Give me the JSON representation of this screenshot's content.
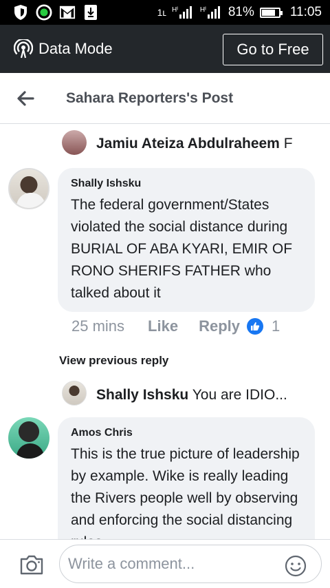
{
  "status_bar": {
    "network_label": "1ʟ",
    "sim1": "Hᴵ",
    "sim2": "Hᴵ",
    "battery_percent": "81%",
    "battery_level": 0.81,
    "time": "11:05",
    "icons": [
      "shield-icon",
      "data-saver-icon",
      "gmail-icon",
      "download-icon",
      "signal-icon",
      "battery-icon"
    ]
  },
  "data_mode": {
    "label": "Data Mode",
    "button": "Go to Free"
  },
  "header": {
    "title": "Sahara Reporters's Post"
  },
  "comments": [
    {
      "type": "reply_preview",
      "name": "Jamiu Ateiza Abdulraheem",
      "text": "F"
    },
    {
      "type": "comment",
      "name": "Shally Ishsku",
      "text": "The federal government/States violated the social distance during BURIAL OF ABA KYARI, EMIR OF RONO SHERIFS FATHER  who talked about it",
      "time": "25 mins",
      "like_label": "Like",
      "reply_label": "Reply",
      "reaction_count": "1"
    },
    {
      "type": "view_previous",
      "text": "View previous reply"
    },
    {
      "type": "reply_preview",
      "name": "Shally Ishsku",
      "text": "You are IDIO..."
    },
    {
      "type": "comment",
      "name": "Amos Chris",
      "text": "This is the true picture of leadership by example. Wike is really leading the Rivers people well by observing and enforcing the social distancing rules"
    }
  ],
  "composer": {
    "placeholder": "Write a comment..."
  },
  "colors": {
    "status_bg": "#000000",
    "data_bar_bg": "#23272b",
    "bubble_bg": "#f0f2f5",
    "like_blue": "#1877f2",
    "muted": "#8d949e"
  }
}
